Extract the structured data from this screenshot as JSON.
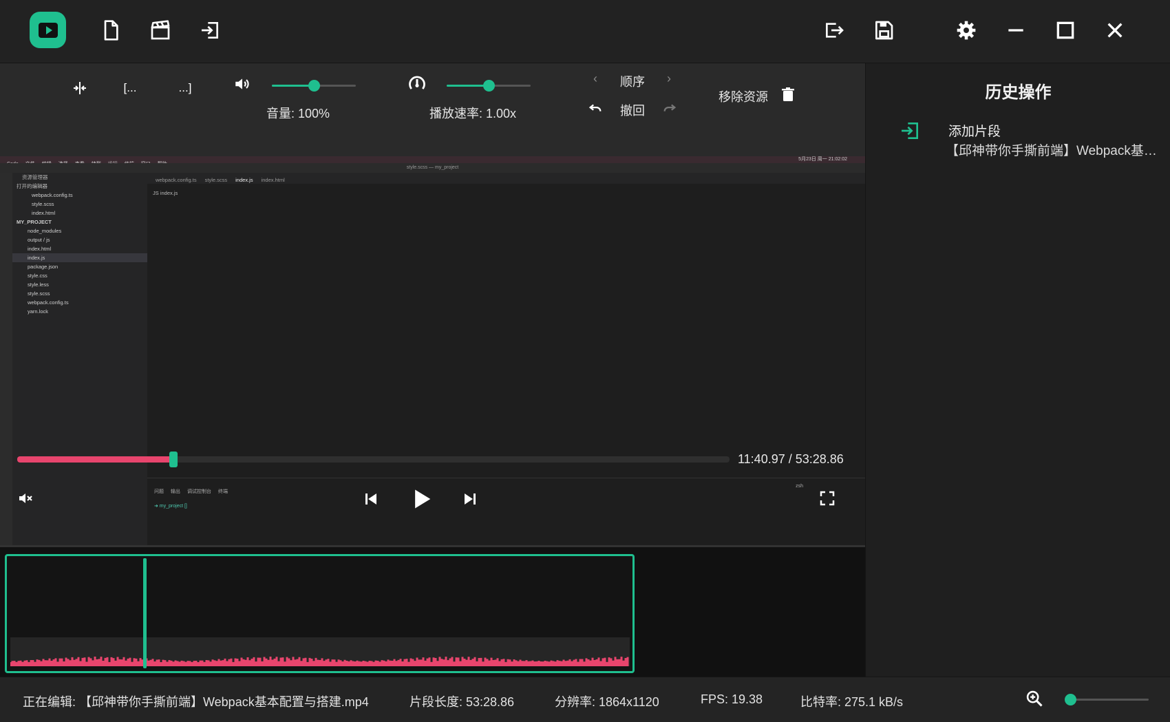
{
  "toolbar": {
    "split_label": "⟊",
    "mark_in_label": "[...",
    "mark_out_label": "...]",
    "volume_text": "音量: 100%",
    "volume_level": 0.5,
    "speed_text": "播放速率: 1.00x",
    "speed_level": 0.5,
    "order_label": "顺序",
    "undo_label": "撤回",
    "remove_label": "移除资源"
  },
  "player": {
    "timecode": "11:40.97 / 53:28.86",
    "progress": 0.219
  },
  "vscode_content": {
    "menu": [
      "Code",
      "文件",
      "编辑",
      "选择",
      "查看",
      "转到",
      "运行",
      "终端",
      "窗口",
      "帮助"
    ],
    "window_title": "style.scss — my_project",
    "clock": "5月23日 周一 21:02:02",
    "explorer_title": "资源管理器",
    "open_editors": "打开的编辑器",
    "open_files": [
      "webpack.config.ts",
      "style.scss",
      "index.html"
    ],
    "project": "MY_PROJECT",
    "files": [
      "node_modules",
      "output / js",
      "index.html",
      "index.js",
      "package.json",
      "style.css",
      "style.less",
      "style.scss",
      "webpack.config.ts",
      "yarn.lock"
    ],
    "tabs": [
      "webpack.config.ts",
      "style.scss",
      "index.js",
      "index.html"
    ],
    "breadcrumb": "JS index.js",
    "terminal_tabs": [
      "问题",
      "输出",
      "调试控制台",
      "终端"
    ],
    "terminal_prompt": "➜ my_project []",
    "terminal_shell": "zsh"
  },
  "history": {
    "title": "历史操作",
    "items": [
      {
        "name": "添加片段",
        "file": "【邱神带你手撕前端】Webpack基本配置与搭建.mp4"
      }
    ]
  },
  "status": {
    "editing": "正在编辑: 【邱神带你手撕前端】Webpack基本配置与搭建.mp4",
    "length": "片段长度: 53:28.86",
    "resolution": "分辨率: 1864x1120",
    "fps": "FPS: 19.38",
    "bitrate": "比特率: 275.1 kB/s",
    "zoom_level": 0.05
  },
  "colors": {
    "accent": "#1fbf8f",
    "progress": "#e8456d",
    "background": "#1f1f1f"
  }
}
